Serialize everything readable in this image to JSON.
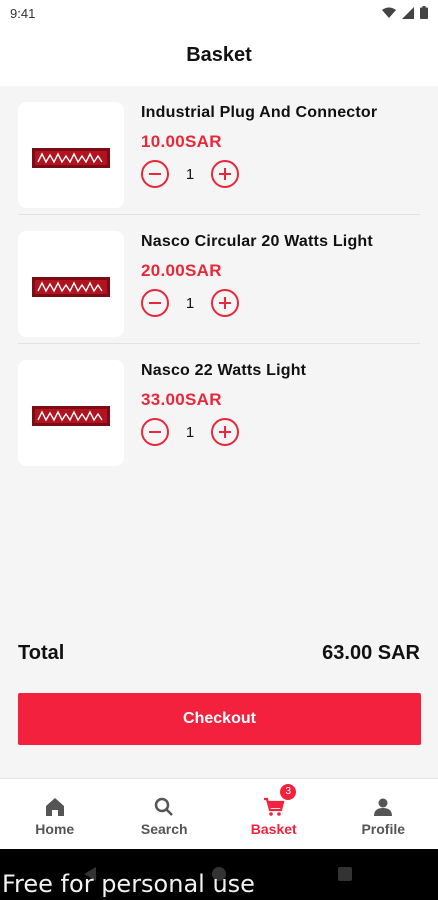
{
  "status_bar": {
    "time": "9:41"
  },
  "header": {
    "title": "Basket"
  },
  "cart": {
    "items": [
      {
        "name": "Industrial Plug And Connector",
        "price": "10.00SAR",
        "quantity": "1"
      },
      {
        "name": "Nasco Circular 20 Watts Light",
        "price": "20.00SAR",
        "quantity": "1"
      },
      {
        "name": "Nasco 22 Watts Light",
        "price": "33.00SAR",
        "quantity": "1"
      }
    ]
  },
  "summary": {
    "total_label": "Total",
    "total_value": "63.00 SAR"
  },
  "checkout": {
    "label": "Checkout"
  },
  "bottom_nav": {
    "items": [
      {
        "label": "Home",
        "icon": "home-icon"
      },
      {
        "label": "Search",
        "icon": "search-icon"
      },
      {
        "label": "Basket",
        "icon": "cart-icon",
        "badge": "3"
      },
      {
        "label": "Profile",
        "icon": "profile-icon"
      }
    ],
    "active": "Basket"
  },
  "watermark": {
    "text": "Free for personal use"
  },
  "colors": {
    "accent": "#f4213e",
    "price": "#e8283a",
    "background": "#f5f5f5"
  }
}
